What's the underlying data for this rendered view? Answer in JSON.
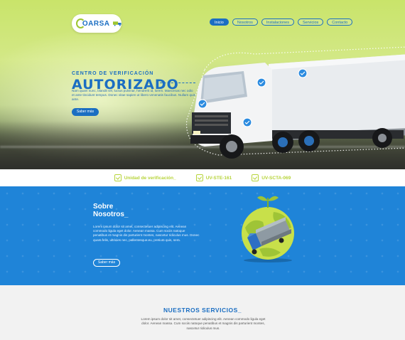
{
  "header": {
    "logo_text": "OARSA",
    "nav": [
      {
        "label": "Inicio",
        "active": true
      },
      {
        "label": "Nosotros",
        "active": false
      },
      {
        "label": "Instalaciones",
        "active": false
      },
      {
        "label": "Servicios",
        "active": false
      },
      {
        "label": "Contacto",
        "active": false
      }
    ]
  },
  "hero": {
    "tagline": "CENTRO DE VERIFICACIÓN",
    "headline": "AUTORIZADO",
    "body": "Nam quam nunc, blandit vel, luctus pulvinar, hendrerit id, lorem. Maecenas nec odio et ante tincidunt tempus. Donec vitae sapien ut libero venenatis faucibus. Nullam quis ante.",
    "button": "Saber más"
  },
  "strip": {
    "items": [
      "Unidad de verificación_",
      "UV-STE-161",
      "UV-SCTA-069"
    ]
  },
  "about": {
    "title_line1": "Sobre",
    "title_line2": "Nosotros_",
    "body": "Lorem ipsum dolor sit amet, consectetuer adipiscing elit. Aenean commodo ligula eget dolor. Aenean massa. Cum sociis natoque penatibus et magnis dis parturient montes, nascetur ridiculus mus. Donec quam felis, ultricies nec, pellentesque eu, pretium quis, sem.",
    "button": "Saber más"
  },
  "services": {
    "title": "NUESTROS SERVICIOS_",
    "body": "Lorem ipsum dolor sit amet, consectetuer adipiscing elit. Aenean commodo ligula eget dolor. Aenean massa. Cum sociis natoque penatibus et magnis dis parturient montes, nascetur ridiculus mus."
  },
  "colors": {
    "primary": "#1b6ec2",
    "accent_green": "#b7d43a",
    "about_bg": "#1f84d8"
  }
}
